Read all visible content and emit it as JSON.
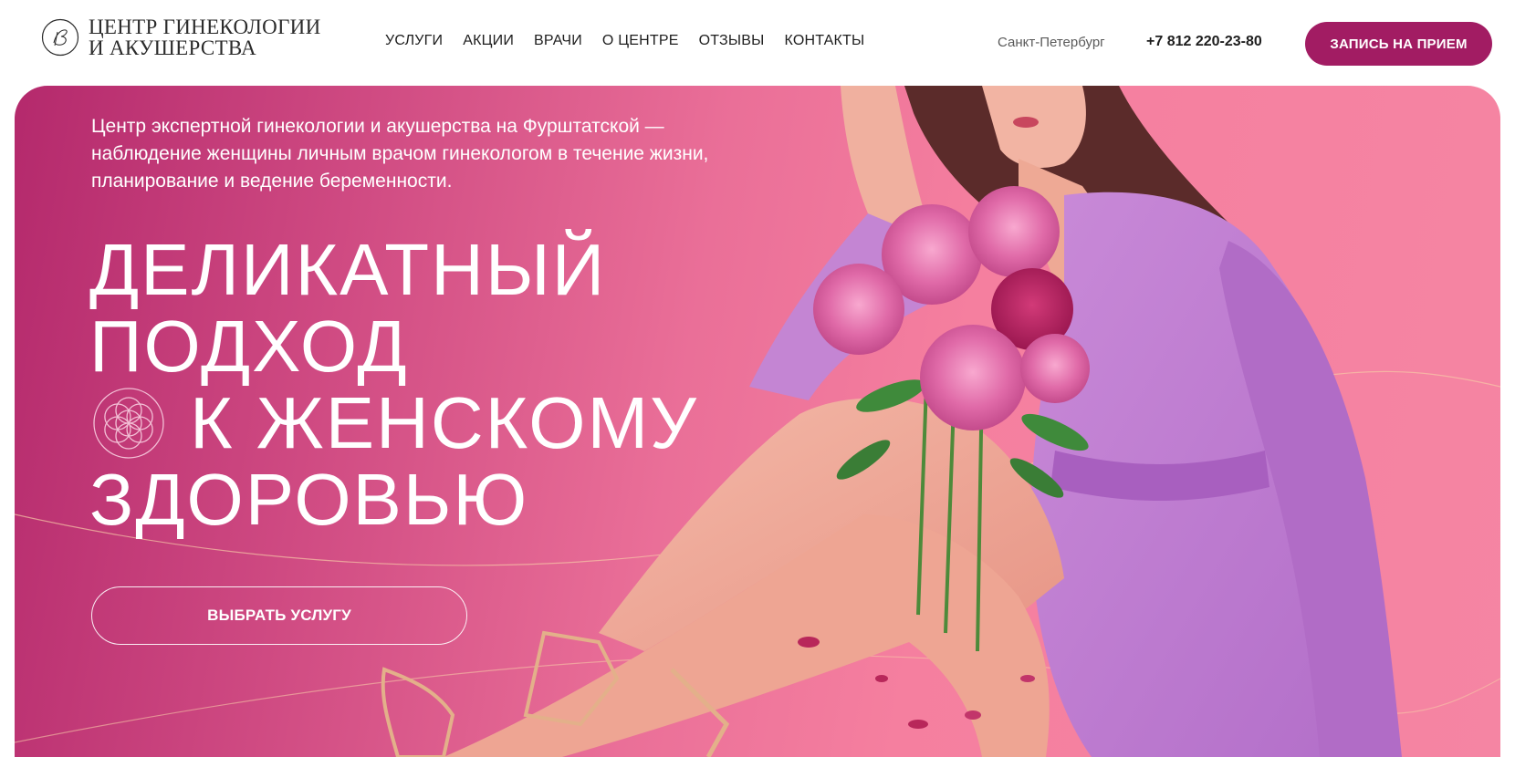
{
  "header": {
    "logo_line1": "ЦЕНТР ГИНЕКОЛОГИИ",
    "logo_line2": "И АКУШЕРСТВА",
    "logo_icon": "monogram-logo-icon",
    "nav": [
      "УСЛУГИ",
      "АКЦИИ",
      "ВРАЧИ",
      "О ЦЕНТРЕ",
      "ОТЗЫВЫ",
      "КОНТАКТЫ"
    ],
    "city": "Санкт-Петербург",
    "phone": "+7 812 220-23-80",
    "cta_label": "ЗАПИСЬ НА ПРИЕМ"
  },
  "hero": {
    "intro_line1": "Центр экспертной гинекологии и акушерства на Фурштатской —",
    "intro_line2": "наблюдение женщины личным врачом гинекологом в течение жизни,",
    "intro_line3": "планирование и ведение беременности.",
    "headline_line1": "ДЕЛИКАТНЫЙ",
    "headline_line2": "ПОДХОД",
    "headline_line3": "К ЖЕНСКОМУ",
    "headline_line4": "ЗДОРОВЬЮ",
    "headline_icon": "flower-of-life-icon",
    "button_label": "ВЫБРАТЬ УСЛУГУ",
    "image": "woman-with-peonies-photo"
  },
  "colors": {
    "brand": "#a21c63",
    "hero_start": "#b4296c",
    "hero_end": "#f585a3",
    "dress": "#c07cd0"
  }
}
